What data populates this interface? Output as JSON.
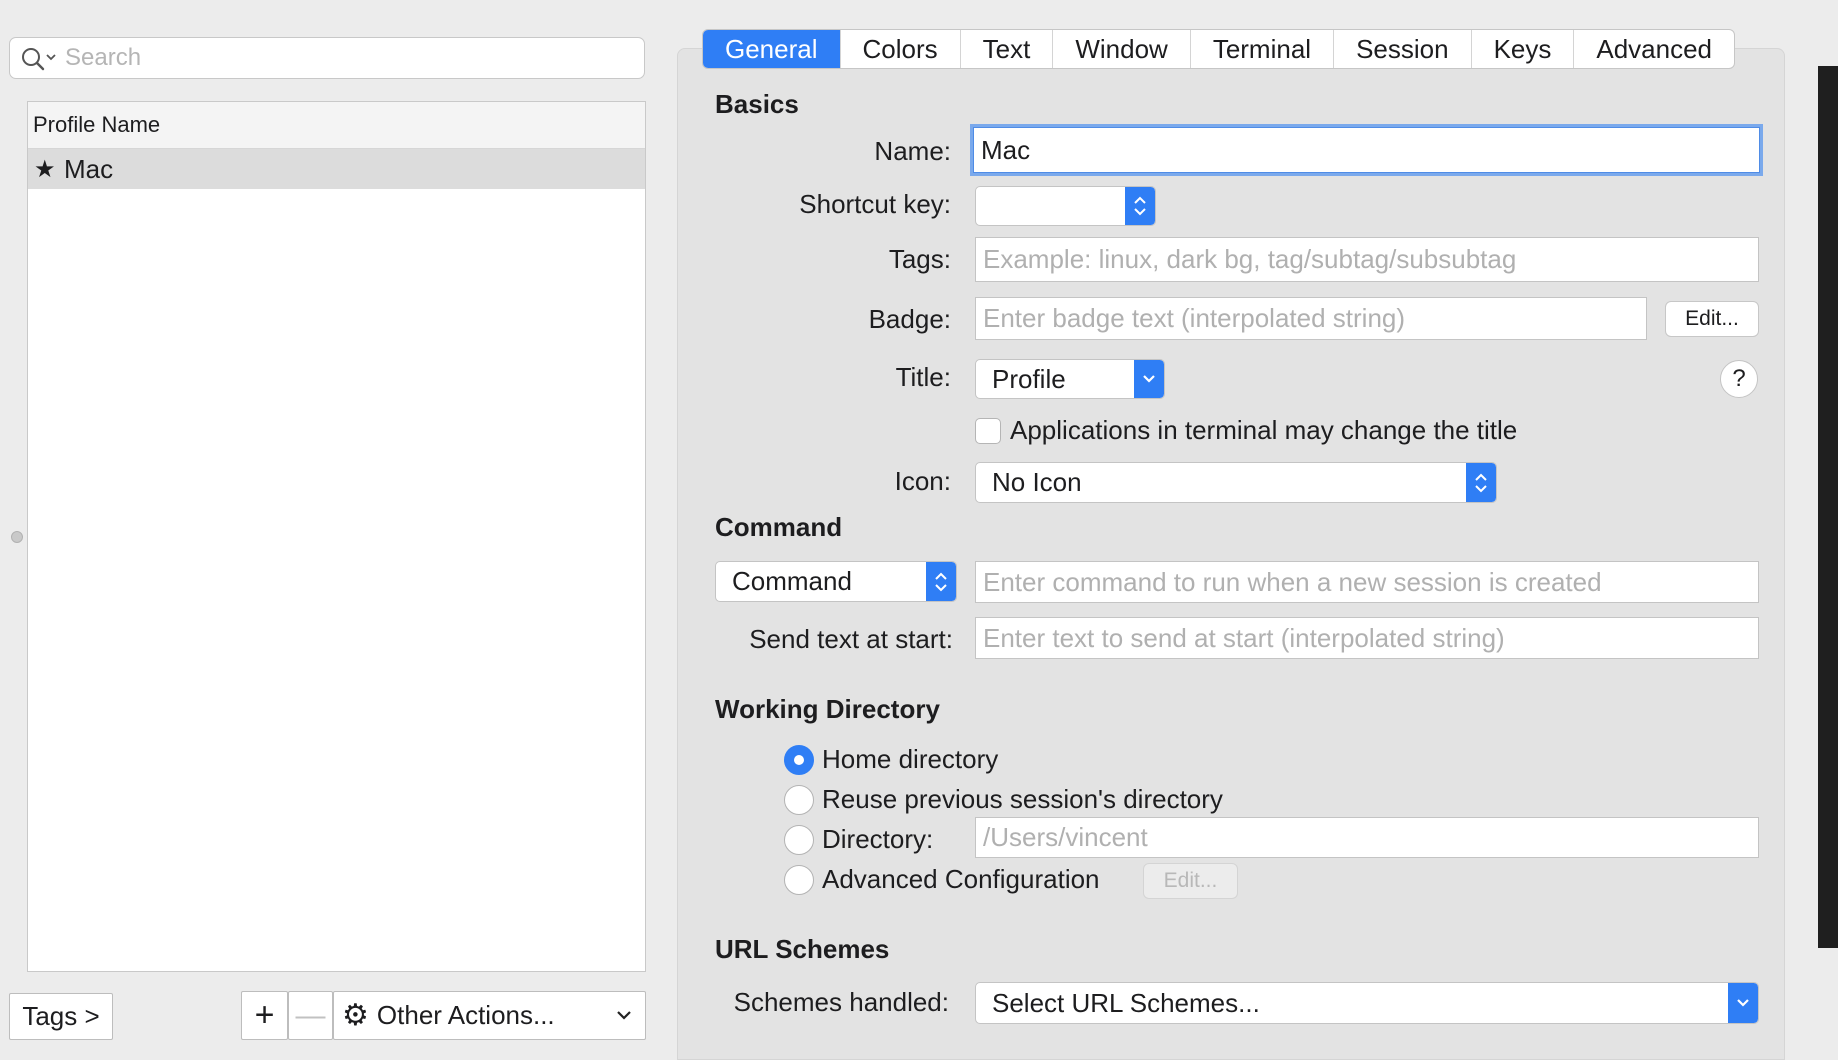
{
  "search": {
    "placeholder": "Search",
    "icon": "search-icon"
  },
  "profiles": {
    "column_header": "Profile Name",
    "items": [
      {
        "name": "Mac",
        "default": true,
        "icon": "star-icon"
      }
    ]
  },
  "footer": {
    "tags_label": "Tags >",
    "add_label": "+",
    "remove_label": "—",
    "other_actions_label": "Other Actions..."
  },
  "tabs": [
    {
      "label": "General",
      "active": true
    },
    {
      "label": "Colors"
    },
    {
      "label": "Text"
    },
    {
      "label": "Window"
    },
    {
      "label": "Terminal"
    },
    {
      "label": "Session"
    },
    {
      "label": "Keys"
    },
    {
      "label": "Advanced"
    }
  ],
  "basics": {
    "heading": "Basics",
    "name_label": "Name:",
    "name_value": "Mac",
    "shortcut_label": "Shortcut key:",
    "shortcut_value": "",
    "tags_label": "Tags:",
    "tags_placeholder": "Example: linux, dark bg, tag/subtag/subsubtag",
    "badge_label": "Badge:",
    "badge_placeholder": "Enter badge text (interpolated string)",
    "badge_edit": "Edit...",
    "title_label": "Title:",
    "title_value": "Profile",
    "help": "?",
    "apps_change_title": "Applications in terminal may change the title",
    "icon_label": "Icon:",
    "icon_value": "No Icon"
  },
  "command": {
    "heading": "Command",
    "type_value": "Command",
    "command_placeholder": "Enter command to run when a new session is created",
    "send_text_label": "Send text at start:",
    "send_text_placeholder": "Enter text to send at start (interpolated string)"
  },
  "working_directory": {
    "heading": "Working Directory",
    "options": [
      {
        "label": "Home directory",
        "selected": true
      },
      {
        "label": "Reuse previous session's directory",
        "selected": false
      },
      {
        "label": "Directory:",
        "selected": false
      },
      {
        "label": "Advanced Configuration",
        "selected": false
      }
    ],
    "directory_placeholder": "/Users/vincent",
    "advanced_edit": "Edit..."
  },
  "url_schemes": {
    "heading": "URL Schemes",
    "label": "Schemes handled:",
    "value": "Select URL Schemes..."
  },
  "colors": {
    "accent": "#2f7ef5",
    "focus_ring": "#7aa9ec"
  }
}
